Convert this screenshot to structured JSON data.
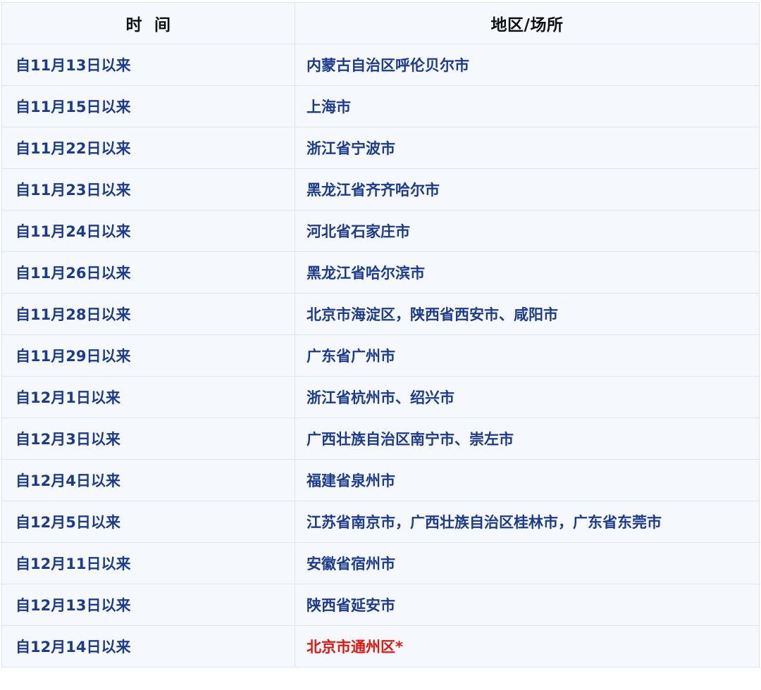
{
  "table": {
    "headers": [
      "时  间",
      "地区/场所"
    ],
    "rows": [
      {
        "time": "自11月13日以来",
        "place": "内蒙古自治区呼伦贝尔市"
      },
      {
        "time": "自11月15日以来",
        "place": "上海市"
      },
      {
        "time": "自11月22日以来",
        "place": "浙江省宁波市"
      },
      {
        "time": "自11月23日以来",
        "place": "黑龙江省齐齐哈尔市"
      },
      {
        "time": "自11月24日以来",
        "place": "河北省石家庄市"
      },
      {
        "time": "自11月26日以来",
        "place": "黑龙江省哈尔滨市"
      },
      {
        "time": "自11月28日以来",
        "place": "北京市海淀区，陕西省西安市、咸阳市"
      },
      {
        "time": "自11月29日以来",
        "place": "广东省广州市"
      },
      {
        "time": "自12月1日以来",
        "place": "浙江省杭州市、绍兴市"
      },
      {
        "time": "自12月3日以来",
        "place": "广西壮族自治区南宁市、崇左市"
      },
      {
        "time": "自12月4日以来",
        "place": "福建省泉州市"
      },
      {
        "time": "自12月5日以来",
        "place": "江苏省南京市，广西壮族自治区桂林市，广东省东莞市"
      },
      {
        "time": "自12月11日以来",
        "place": "安徽省宿州市"
      },
      {
        "time": "自12月13日以来",
        "place": "陕西省延安市"
      },
      {
        "time": "自12月14日以来",
        "place": "北京市通州区*"
      }
    ]
  },
  "colors": {
    "header_text": "#111111",
    "cell_text": "#1c3b8c",
    "highlight_text": "#e3160f",
    "cell_background": "#f5f8fd",
    "border": "#dfe5ee"
  }
}
